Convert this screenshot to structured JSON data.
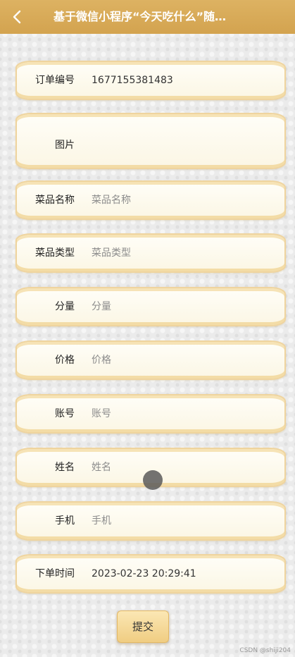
{
  "header": {
    "title": "基于微信小程序“今天吃什么”随…",
    "back_icon": "chevron-left-icon"
  },
  "form": {
    "order_no": {
      "label": "订单编号",
      "value": "1677155381483"
    },
    "image": {
      "label": "图片"
    },
    "dish_name": {
      "label": "菜品名称",
      "placeholder": "菜品名称"
    },
    "dish_type": {
      "label": "菜品类型",
      "placeholder": "菜品类型"
    },
    "portion": {
      "label": "分量",
      "placeholder": "分量"
    },
    "price": {
      "label": "价格",
      "placeholder": "价格"
    },
    "account": {
      "label": "账号",
      "placeholder": "账号"
    },
    "name": {
      "label": "姓名",
      "placeholder": "姓名"
    },
    "phone": {
      "label": "手机",
      "placeholder": "手机"
    },
    "order_time": {
      "label": "下单时间",
      "value": "2023-02-23 20:29:41"
    }
  },
  "submit_label": "提交",
  "watermark": "CSDN @shiji204",
  "colors": {
    "header": "#d8aa57",
    "field_border": "#efd49e",
    "button": "#f3d48d"
  }
}
